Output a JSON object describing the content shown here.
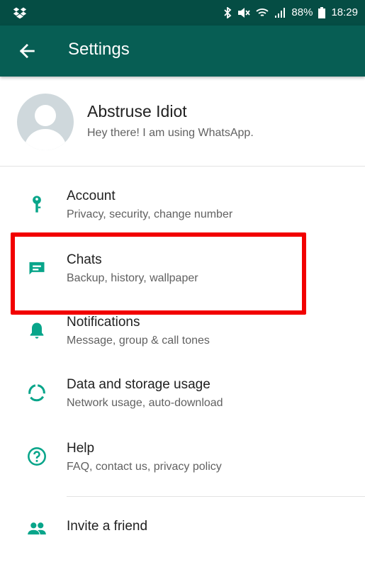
{
  "status_bar": {
    "battery": "88%",
    "time": "18:29",
    "icons": [
      "dropbox-icon",
      "bluetooth-icon",
      "mute-icon",
      "wifi-icon",
      "signal-icon",
      "battery-icon"
    ]
  },
  "app_bar": {
    "title": "Settings"
  },
  "profile": {
    "name": "Abstruse Idiot",
    "status": "Hey there! I am using WhatsApp."
  },
  "settings": [
    {
      "icon": "key-icon",
      "title": "Account",
      "subtitle": "Privacy, security, change number"
    },
    {
      "icon": "chat-icon",
      "title": "Chats",
      "subtitle": "Backup, history, wallpaper"
    },
    {
      "icon": "bell-icon",
      "title": "Notifications",
      "subtitle": "Message, group & call tones"
    },
    {
      "icon": "data-usage-icon",
      "title": "Data and storage usage",
      "subtitle": "Network usage, auto-download"
    },
    {
      "icon": "help-icon",
      "title": "Help",
      "subtitle": "FAQ, contact us, privacy policy"
    },
    {
      "icon": "people-icon",
      "title": "Invite a friend",
      "subtitle": ""
    }
  ],
  "colors": {
    "primary": "#075e54",
    "status_bar": "#054d44",
    "icon": "#08a58a",
    "highlight": "#f20000"
  }
}
